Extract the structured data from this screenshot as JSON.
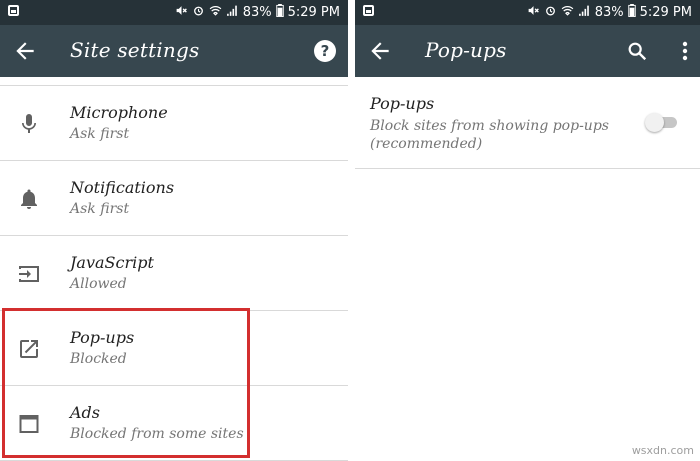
{
  "status_bar": {
    "battery": "83%",
    "time": "5:29 PM"
  },
  "site_settings": {
    "title": "Site settings",
    "items": [
      {
        "label": "Microphone",
        "sublabel": "Ask first",
        "icon": "microphone-icon"
      },
      {
        "label": "Notifications",
        "sublabel": "Ask first",
        "icon": "bell-icon"
      },
      {
        "label": "JavaScript",
        "sublabel": "Allowed",
        "icon": "javascript-icon"
      },
      {
        "label": "Pop-ups",
        "sublabel": "Blocked",
        "icon": "open-in-new-icon"
      },
      {
        "label": "Ads",
        "sublabel": "Blocked from some sites",
        "icon": "window-icon"
      }
    ],
    "highlight_color": "#d32f2f"
  },
  "popups": {
    "title": "Pop-ups",
    "setting_label": "Pop-ups",
    "setting_description": "Block sites from showing pop-ups (recommended)",
    "toggle_on": false
  },
  "watermark": "wsxdn.com",
  "colors": {
    "status_bar": "#263238",
    "app_bar": "#37474f"
  }
}
